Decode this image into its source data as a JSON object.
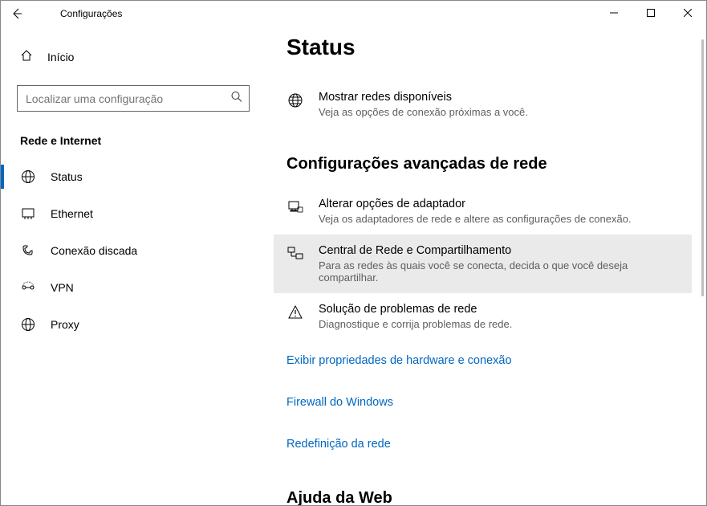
{
  "window": {
    "title": "Configurações"
  },
  "sidebar": {
    "home_label": "Início",
    "search_placeholder": "Localizar uma configuração",
    "section_label": "Rede e Internet",
    "items": [
      {
        "label": "Status",
        "active": true
      },
      {
        "label": "Ethernet",
        "active": false
      },
      {
        "label": "Conexão discada",
        "active": false
      },
      {
        "label": "VPN",
        "active": false
      },
      {
        "label": "Proxy",
        "active": false
      }
    ]
  },
  "main": {
    "page_title": "Status",
    "quick": {
      "show_networks_title": "Mostrar redes disponíveis",
      "show_networks_desc": "Veja as opções de conexão próximas a você."
    },
    "advanced": {
      "heading": "Configurações avançadas de rede",
      "adapter_title": "Alterar opções de adaptador",
      "adapter_desc": "Veja os adaptadores de rede e altere as configurações de conexão.",
      "sharing_title": "Central de Rede e Compartilhamento",
      "sharing_desc": "Para as redes às quais você se conecta, decida o que você deseja compartilhar.",
      "troubleshoot_title": "Solução de problemas de rede",
      "troubleshoot_desc": "Diagnostique e corrija problemas de rede."
    },
    "links": {
      "hw_props": "Exibir propriedades de hardware e conexão",
      "firewall": "Firewall do Windows",
      "reset": "Redefinição da rede"
    },
    "help": {
      "heading": "Ajuda da Web"
    }
  }
}
